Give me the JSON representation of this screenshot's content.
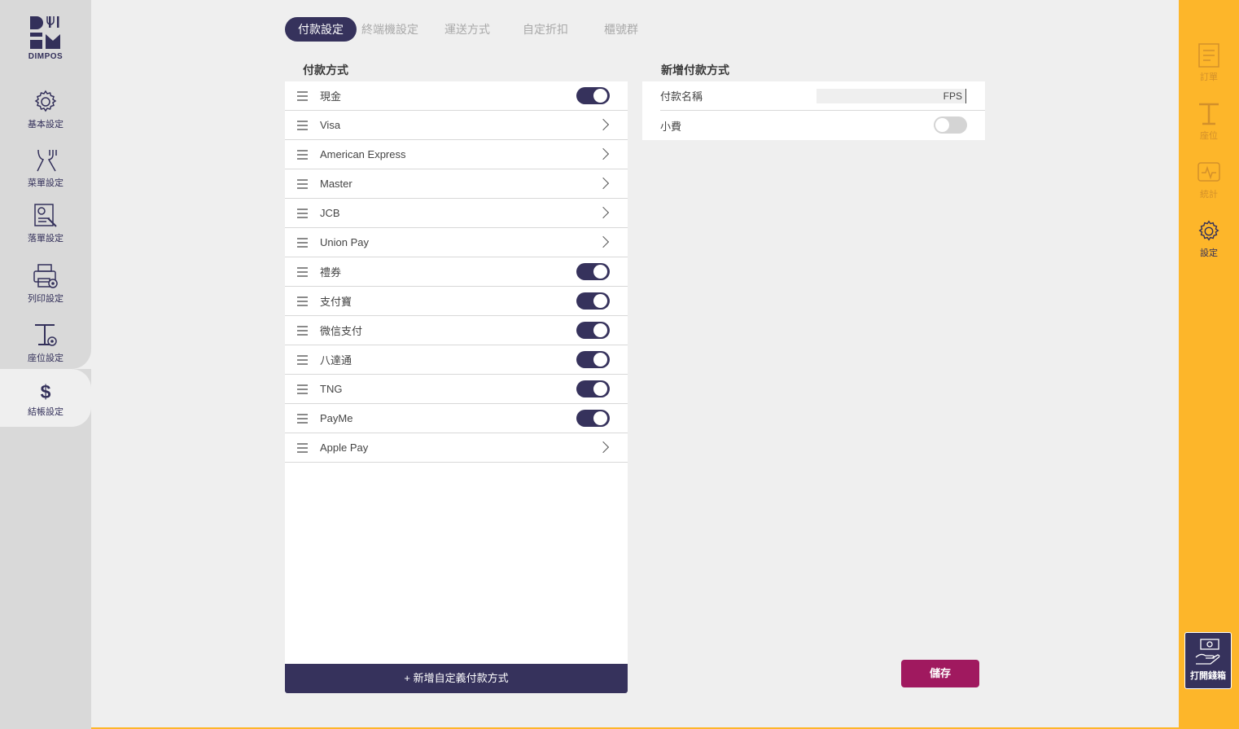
{
  "brand": {
    "logo_text": "DIMPOS"
  },
  "left_nav": [
    {
      "label": "基本設定",
      "icon": "gear-icon"
    },
    {
      "label": "菜單設定",
      "icon": "fork-knife-icon"
    },
    {
      "label": "落單設定",
      "icon": "order-settings-icon"
    },
    {
      "label": "列印設定",
      "icon": "printer-settings-icon"
    },
    {
      "label": "座位設定",
      "icon": "table-settings-icon"
    },
    {
      "label": "結帳設定",
      "icon": "dollar-icon"
    }
  ],
  "tabs": [
    {
      "label": "付款設定",
      "active": true
    },
    {
      "label": "終端機設定"
    },
    {
      "label": "運送方式"
    },
    {
      "label": "自定折扣"
    },
    {
      "label": "櫃號群"
    }
  ],
  "payment_list": {
    "title": "付款方式",
    "items": [
      {
        "label": "現金",
        "control": "toggle-on"
      },
      {
        "label": "Visa",
        "control": "chevron"
      },
      {
        "label": "American Express",
        "control": "chevron"
      },
      {
        "label": "Master",
        "control": "chevron"
      },
      {
        "label": "JCB",
        "control": "chevron"
      },
      {
        "label": "Union Pay",
        "control": "chevron"
      },
      {
        "label": "禮券",
        "control": "toggle-on"
      },
      {
        "label": "支付寶",
        "control": "toggle-on"
      },
      {
        "label": "微信支付",
        "control": "toggle-on"
      },
      {
        "label": "八達通",
        "control": "toggle-on"
      },
      {
        "label": "TNG",
        "control": "toggle-on"
      },
      {
        "label": "PayMe",
        "control": "toggle-on"
      },
      {
        "label": "Apple Pay",
        "control": "chevron"
      }
    ],
    "add_button": "+ 新增自定義付款方式"
  },
  "new_payment": {
    "title": "新增付款方式",
    "name_label": "付款名稱",
    "name_value": "FPS",
    "tip_label": "小費",
    "tip_enabled": false,
    "save_button": "儲存"
  },
  "right_nav": [
    {
      "label": "訂單",
      "icon": "order-list-icon",
      "state": "dim"
    },
    {
      "label": "座位",
      "icon": "table-icon",
      "state": "dim"
    },
    {
      "label": "統計",
      "icon": "statistics-icon",
      "state": "dim"
    },
    {
      "label": "設定",
      "icon": "gear-icon",
      "state": "active"
    }
  ],
  "cash_drawer_button": "打開錢箱",
  "colors": {
    "primary": "#36325c",
    "accent_yellow": "#fdb62a",
    "save": "#a0195f",
    "sidebar_grey": "#d9d9d9",
    "page_bg": "#efefef"
  }
}
